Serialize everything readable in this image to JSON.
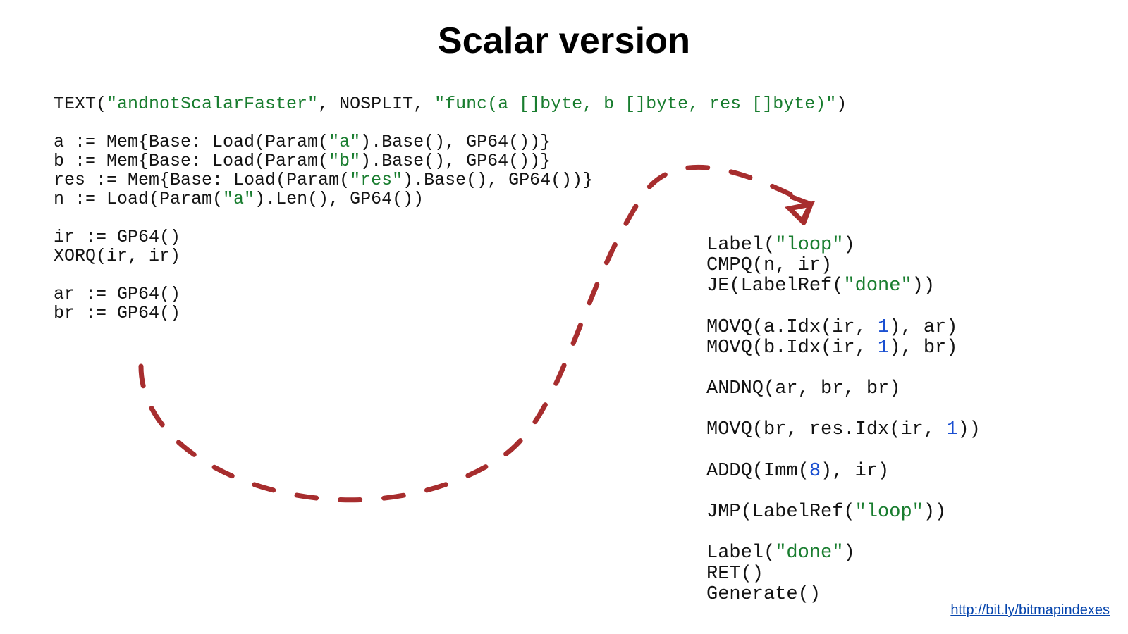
{
  "slide": {
    "title": "Scalar version",
    "footer_link_text": "http://bit.ly/bitmapindexes",
    "left_code_html": "TEXT(<span class='s'>\"andnotScalarFaster\"</span>, NOSPLIT, <span class='s'>\"func(a []byte, b []byte, res []byte)\"</span>)\n\na := Mem{Base: Load(Param(<span class='s'>\"a\"</span>).Base(), GP64())}\nb := Mem{Base: Load(Param(<span class='s'>\"b\"</span>).Base(), GP64())}\nres := Mem{Base: Load(Param(<span class='s'>\"res\"</span>).Base(), GP64())}\nn := Load(Param(<span class='s'>\"a\"</span>).Len(), GP64())\n\nir := GP64()\nXORQ(ir, ir)\n\nar := GP64()\nbr := GP64()",
    "right_code_html": "Label(<span class='s'>\"loop\"</span>)\nCMPQ(n, ir)\nJE(LabelRef(<span class='s'>\"done\"</span>))\n\nMOVQ(a.Idx(ir, <span class='n'>1</span>), ar)\nMOVQ(b.Idx(ir, <span class='n'>1</span>), br)\n\nANDNQ(ar, br, br)\n\nMOVQ(br, res.Idx(ir, <span class='n'>1</span>))\n\nADDQ(Imm(<span class='n'>8</span>), ir)\n\nJMP(LabelRef(<span class='s'>\"loop\"</span>))\n\nLabel(<span class='s'>\"done\"</span>)\nRET()\nGenerate()"
  }
}
